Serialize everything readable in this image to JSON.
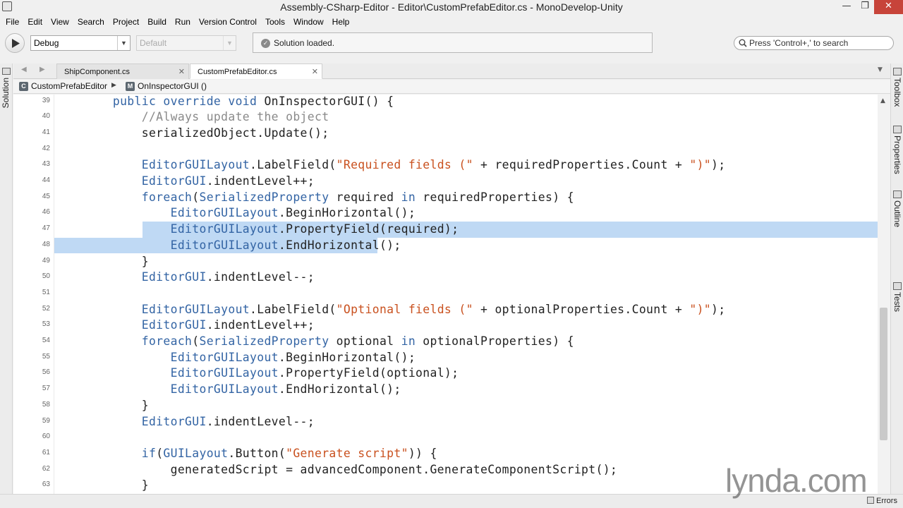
{
  "window": {
    "title": "Assembly-CSharp-Editor - Editor\\CustomPrefabEditor.cs - MonoDevelop-Unity",
    "minimize": "—",
    "maximize": "❐",
    "close": "✕"
  },
  "menu": [
    "File",
    "Edit",
    "View",
    "Search",
    "Project",
    "Build",
    "Run",
    "Version Control",
    "Tools",
    "Window",
    "Help"
  ],
  "toolbar": {
    "configuration": "Debug",
    "target": "Default",
    "status": "Solution loaded.",
    "search_placeholder": "Press 'Control+,' to search"
  },
  "left_pad": "Solution",
  "right_pads": [
    "Toolbox",
    "Properties",
    "Document Outline",
    "Unit Tests"
  ],
  "tabs": [
    {
      "label": "ShipComponent.cs",
      "active": false
    },
    {
      "label": "CustomPrefabEditor.cs",
      "active": true
    }
  ],
  "breadcrumb": {
    "class_name": "CustomPrefabEditor",
    "method_name": "OnInspectorGUI ()"
  },
  "code_lines": [
    {
      "n": "39",
      "segs": [
        {
          "t": "    "
        },
        {
          "t": "public override void",
          "c": "kw"
        },
        {
          "t": " OnInspectorGUI() {"
        }
      ]
    },
    {
      "n": "40",
      "segs": [
        {
          "t": "        "
        },
        {
          "t": "//Always update the object",
          "c": "cm"
        }
      ]
    },
    {
      "n": "41",
      "segs": [
        {
          "t": "        serializedObject.Update();"
        }
      ]
    },
    {
      "n": "42",
      "segs": []
    },
    {
      "n": "43",
      "segs": [
        {
          "t": "        "
        },
        {
          "t": "EditorGUILayout",
          "c": "ty"
        },
        {
          "t": ".LabelField("
        },
        {
          "t": "\"Required fields (\"",
          "c": "st"
        },
        {
          "t": " + requiredProperties.Count + "
        },
        {
          "t": "\")\"",
          "c": "st"
        },
        {
          "t": ");"
        }
      ]
    },
    {
      "n": "44",
      "segs": [
        {
          "t": "        "
        },
        {
          "t": "EditorGUI",
          "c": "ty"
        },
        {
          "t": ".indentLevel++;"
        }
      ]
    },
    {
      "n": "45",
      "segs": [
        {
          "t": "        "
        },
        {
          "t": "foreach",
          "c": "kw"
        },
        {
          "t": "("
        },
        {
          "t": "SerializedProperty",
          "c": "ty"
        },
        {
          "t": " required "
        },
        {
          "t": "in",
          "c": "kw"
        },
        {
          "t": " requiredProperties) {"
        }
      ]
    },
    {
      "n": "46",
      "segs": [
        {
          "t": "            "
        },
        {
          "t": "EditorGUILayout",
          "c": "ty"
        },
        {
          "t": ".BeginHorizontal();"
        }
      ]
    },
    {
      "n": "47",
      "segs": [
        {
          "t": "            "
        },
        {
          "t": "EditorGUILayout",
          "c": "ty"
        },
        {
          "t": ".PropertyField(required);"
        }
      ]
    },
    {
      "n": "48",
      "segs": [
        {
          "t": "            "
        },
        {
          "t": "EditorGUILayout",
          "c": "ty"
        },
        {
          "t": ".EndHorizontal();"
        }
      ]
    },
    {
      "n": "49",
      "segs": [
        {
          "t": "        }"
        }
      ]
    },
    {
      "n": "50",
      "segs": [
        {
          "t": "        "
        },
        {
          "t": "EditorGUI",
          "c": "ty"
        },
        {
          "t": ".indentLevel--;"
        }
      ]
    },
    {
      "n": "51",
      "segs": []
    },
    {
      "n": "52",
      "segs": [
        {
          "t": "        "
        },
        {
          "t": "EditorGUILayout",
          "c": "ty"
        },
        {
          "t": ".LabelField("
        },
        {
          "t": "\"Optional fields (\"",
          "c": "st"
        },
        {
          "t": " + optionalProperties.Count + "
        },
        {
          "t": "\")\"",
          "c": "st"
        },
        {
          "t": ");"
        }
      ]
    },
    {
      "n": "53",
      "segs": [
        {
          "t": "        "
        },
        {
          "t": "EditorGUI",
          "c": "ty"
        },
        {
          "t": ".indentLevel++;"
        }
      ]
    },
    {
      "n": "54",
      "segs": [
        {
          "t": "        "
        },
        {
          "t": "foreach",
          "c": "kw"
        },
        {
          "t": "("
        },
        {
          "t": "SerializedProperty",
          "c": "ty"
        },
        {
          "t": " optional "
        },
        {
          "t": "in",
          "c": "kw"
        },
        {
          "t": " optionalProperties) {"
        }
      ]
    },
    {
      "n": "55",
      "segs": [
        {
          "t": "            "
        },
        {
          "t": "EditorGUILayout",
          "c": "ty"
        },
        {
          "t": ".BeginHorizontal();"
        }
      ]
    },
    {
      "n": "56",
      "segs": [
        {
          "t": "            "
        },
        {
          "t": "EditorGUILayout",
          "c": "ty"
        },
        {
          "t": ".PropertyField(optional);"
        }
      ]
    },
    {
      "n": "57",
      "segs": [
        {
          "t": "            "
        },
        {
          "t": "EditorGUILayout",
          "c": "ty"
        },
        {
          "t": ".EndHorizontal();"
        }
      ]
    },
    {
      "n": "58",
      "segs": [
        {
          "t": "        }"
        }
      ]
    },
    {
      "n": "59",
      "segs": [
        {
          "t": "        "
        },
        {
          "t": "EditorGUI",
          "c": "ty"
        },
        {
          "t": ".indentLevel--;"
        }
      ]
    },
    {
      "n": "60",
      "segs": []
    },
    {
      "n": "61",
      "segs": [
        {
          "t": "        "
        },
        {
          "t": "if",
          "c": "kw"
        },
        {
          "t": "("
        },
        {
          "t": "GUILayout",
          "c": "ty"
        },
        {
          "t": ".Button("
        },
        {
          "t": "\"Generate script\"",
          "c": "st"
        },
        {
          "t": ")) {"
        }
      ]
    },
    {
      "n": "62",
      "segs": [
        {
          "t": "            generatedScript = advancedComponent.GenerateComponentScript();"
        }
      ]
    },
    {
      "n": "63",
      "segs": [
        {
          "t": "        }"
        }
      ]
    }
  ],
  "selection": {
    "from_line": "47",
    "to_line": "48"
  },
  "syntax_colors": {
    "kw": "#3364a4",
    "cm": "#8a8a8a",
    "ty": "#3364a4",
    "st": "#c9511f",
    "plain": "#222222"
  },
  "status_bar": {
    "errors_label": "Errors"
  },
  "watermark": "lynda.com"
}
